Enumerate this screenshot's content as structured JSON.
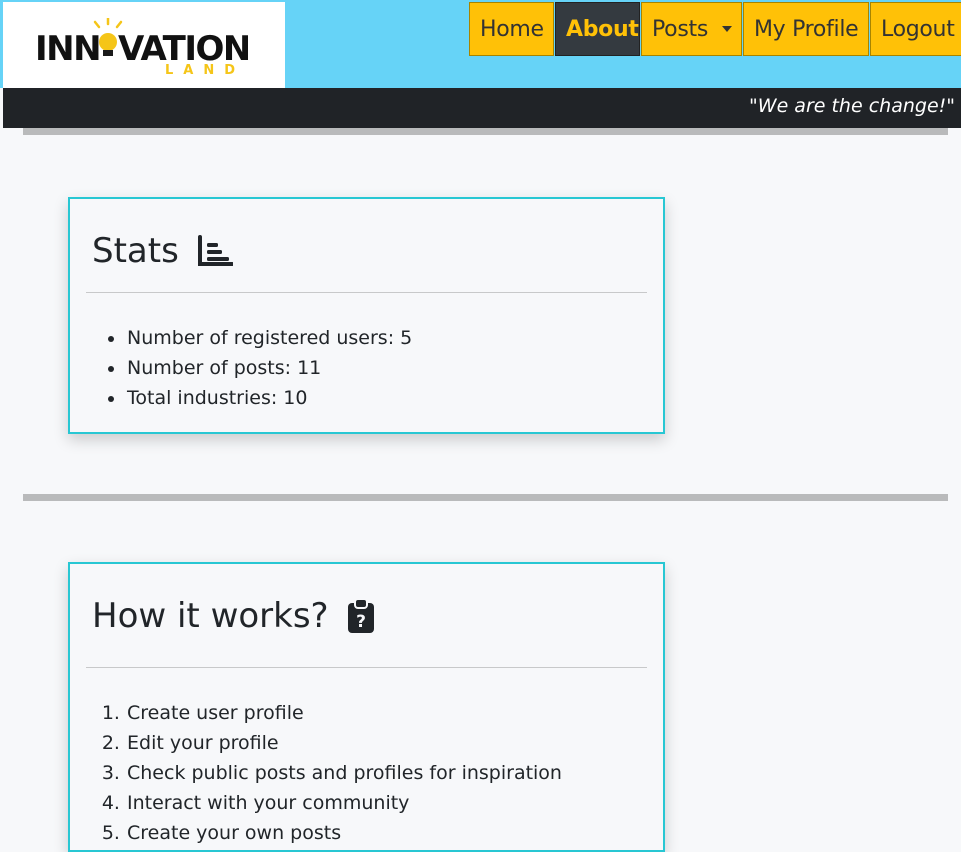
{
  "brand": {
    "logo_main": "INNOVATION",
    "logo_sub": "LAND"
  },
  "nav": {
    "items": [
      {
        "label": "Home"
      },
      {
        "label": "About",
        "active": true
      },
      {
        "label": "Posts",
        "dropdown": true
      },
      {
        "label": "My Profile"
      },
      {
        "label": "Logout"
      }
    ]
  },
  "slogan": "\"We are the change!\"",
  "stats": {
    "title": "Stats",
    "icon": "chart-bar-icon",
    "items": [
      "Number of registered users: 5",
      "Number of posts: 11",
      "Total industries: 10"
    ]
  },
  "how": {
    "title": "How it works?",
    "icon": "clipboard-question-icon",
    "steps": [
      "Create user profile",
      "Edit your profile",
      "Check public posts and profiles for inspiration",
      "Interact with your community",
      "Create your own posts"
    ]
  },
  "colors": {
    "header_bg": "#66d3f7",
    "nav_button": "#ffc107",
    "nav_active_bg": "#343a40",
    "card_border": "#28c7d3",
    "slogan_bar": "#202327"
  }
}
